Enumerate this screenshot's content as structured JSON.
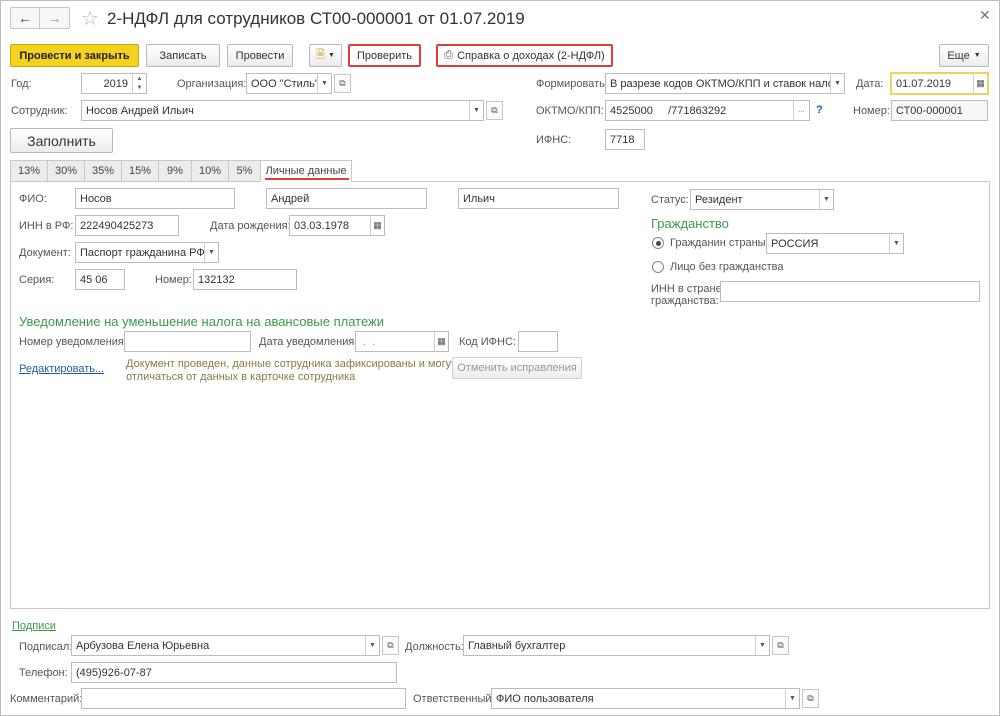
{
  "title": "2-НДФЛ для сотрудников СТ00-000001 от 01.07.2019",
  "toolbar": {
    "post_close": "Провести и закрыть",
    "save": "Записать",
    "post": "Провести",
    "check": "Проверить",
    "income_ref": "Справка о доходах (2-НДФЛ)",
    "more": "Еще"
  },
  "header": {
    "year_label": "Год:",
    "year_value": "2019",
    "org_label": "Организация:",
    "org_value": "ООО \"Стиль\"",
    "form_label": "Формировать:",
    "form_value": "В разрезе кодов ОКТМО/КПП и ставок налога",
    "date_label": "Дата:",
    "date_value": "01.07.2019",
    "employee_label": "Сотрудник:",
    "employee_value": "Носов Андрей Ильич",
    "oktmo_label": "ОКТМО/КПП:",
    "oktmo_value": "4525000     /771863292",
    "help": "?",
    "number_label": "Номер:",
    "number_value": "СТ00-000001",
    "fill_button": "Заполнить",
    "ifns_label": "ИФНС:",
    "ifns_value": "7718"
  },
  "tabs": [
    "13%",
    "30%",
    "35%",
    "15%",
    "9%",
    "10%",
    "5%",
    "Личные данные"
  ],
  "personal": {
    "fio_label": "ФИО:",
    "last_name": "Носов",
    "first_name": "Андрей",
    "middle_name": "Ильич",
    "status_label": "Статус:",
    "status_value": "Резидент",
    "inn_label": "ИНН в РФ:",
    "inn_value": "222490425273",
    "birth_label": "Дата рождения:",
    "birth_value": "03.03.1978",
    "doc_label": "Документ:",
    "doc_value": "Паспорт гражданина РФ",
    "series_label": "Серия:",
    "series_value": "45 06",
    "docnum_label": "Номер:",
    "docnum_value": "132132",
    "citizenship_title": "Гражданство",
    "citizen_label": "Гражданин страны:",
    "citizen_value": "РОССИЯ",
    "stateless_label": "Лицо без гражданства",
    "foreign_inn_label1": "ИНН в стране",
    "foreign_inn_label2": "гражданства:"
  },
  "notice": {
    "title": "Уведомление на уменьшение налога на авансовые платежи",
    "num_label": "Номер уведомления:",
    "date_label": "Дата уведомления:",
    "date_placeholder": " .  .",
    "ifns_code_label": "Код ИФНС:",
    "edit_link": "Редактировать...",
    "info_line1": "Документ проведен, данные сотрудника зафиксированы и могут",
    "info_line2": "отличаться от данных в карточке сотрудника",
    "cancel_button": "Отменить исправления"
  },
  "footer": {
    "signatures_link": "Подписи",
    "signed_label": "Подписал:",
    "signed_value": "Арбузова Елена Юрьевна",
    "position_label": "Должность:",
    "position_value": "Главный бухгалтер",
    "phone_label": "Телефон:",
    "phone_value": "(495)926-07-87",
    "comment_label": "Комментарий:",
    "responsible_label": "Ответственный:",
    "responsible_value": "ФИО пользователя"
  },
  "colors": {
    "primary_button": "#f4d21f",
    "accent_green": "#3c9a4a",
    "highlight_red": "#d9403a",
    "focus_yellow": "#f0d35a"
  }
}
